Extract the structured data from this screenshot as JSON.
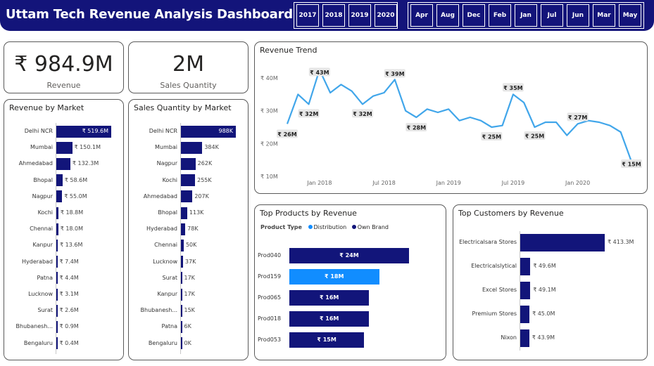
{
  "header": {
    "title": "Uttam Tech Revenue Analysis Dashboard",
    "years": [
      "2017",
      "2018",
      "2019",
      "2020"
    ],
    "months": [
      "Apr",
      "Aug",
      "Dec",
      "Feb",
      "Jan",
      "Jul",
      "Jun",
      "Mar",
      "May"
    ]
  },
  "colors": {
    "navy": "#12157a",
    "accent": "#118dff",
    "line": "#41a6ea"
  },
  "kpis": {
    "revenue": {
      "value": "₹ 984.9M",
      "label": "Revenue"
    },
    "sales_qty": {
      "value": "2M",
      "label": "Sales Quantity"
    }
  },
  "revenue_by_market": {
    "title": "Revenue by Market",
    "rows": [
      {
        "market": "Delhi NCR",
        "value": 519.6,
        "label": "₹ 519.6M"
      },
      {
        "market": "Mumbai",
        "value": 150.1,
        "label": "₹ 150.1M"
      },
      {
        "market": "Ahmedabad",
        "value": 132.3,
        "label": "₹ 132.3M"
      },
      {
        "market": "Bhopal",
        "value": 58.6,
        "label": "₹ 58.6M"
      },
      {
        "market": "Nagpur",
        "value": 55.0,
        "label": "₹ 55.0M"
      },
      {
        "market": "Kochi",
        "value": 18.8,
        "label": "₹ 18.8M"
      },
      {
        "market": "Chennai",
        "value": 18.0,
        "label": "₹ 18.0M"
      },
      {
        "market": "Kanpur",
        "value": 13.6,
        "label": "₹ 13.6M"
      },
      {
        "market": "Hyderabad",
        "value": 7.4,
        "label": "₹ 7.4M"
      },
      {
        "market": "Patna",
        "value": 4.4,
        "label": "₹ 4.4M"
      },
      {
        "market": "Lucknow",
        "value": 3.1,
        "label": "₹ 3.1M"
      },
      {
        "market": "Surat",
        "value": 2.6,
        "label": "₹ 2.6M"
      },
      {
        "market": "Bhubanesh...",
        "value": 0.9,
        "label": "₹ 0.9M"
      },
      {
        "market": "Bengaluru",
        "value": 0.4,
        "label": "₹ 0.4M"
      }
    ]
  },
  "sales_qty_by_market": {
    "title": "Sales Quantity by Market",
    "rows": [
      {
        "market": "Delhi NCR",
        "value": 988,
        "label": "988K"
      },
      {
        "market": "Mumbai",
        "value": 384,
        "label": "384K"
      },
      {
        "market": "Nagpur",
        "value": 262,
        "label": "262K"
      },
      {
        "market": "Kochi",
        "value": 255,
        "label": "255K"
      },
      {
        "market": "Ahmedabad",
        "value": 207,
        "label": "207K"
      },
      {
        "market": "Bhopal",
        "value": 113,
        "label": "113K"
      },
      {
        "market": "Hyderabad",
        "value": 78,
        "label": "78K"
      },
      {
        "market": "Chennai",
        "value": 50,
        "label": "50K"
      },
      {
        "market": "Lucknow",
        "value": 37,
        "label": "37K"
      },
      {
        "market": "Surat",
        "value": 17,
        "label": "17K"
      },
      {
        "market": "Kanpur",
        "value": 17,
        "label": "17K"
      },
      {
        "market": "Bhubanesh...",
        "value": 15,
        "label": "15K"
      },
      {
        "market": "Patna",
        "value": 6,
        "label": "6K"
      },
      {
        "market": "Bengaluru",
        "value": 0,
        "label": "0K"
      }
    ]
  },
  "chart_data": [
    {
      "type": "line",
      "title": "Revenue Trend",
      "xlabel": "",
      "ylabel": "",
      "y_ticks": [
        "₹ 10M",
        "₹ 20M",
        "₹ 30M",
        "₹ 40M"
      ],
      "ylim": [
        10,
        43
      ],
      "x_ticks": [
        "Jan 2018",
        "Jul 2018",
        "Jan 2019",
        "Jul 2019",
        "Jan 2020"
      ],
      "x": [
        "2017-10",
        "2017-11",
        "2017-12",
        "2018-01",
        "2018-02",
        "2018-03",
        "2018-04",
        "2018-05",
        "2018-06",
        "2018-07",
        "2018-08",
        "2018-09",
        "2018-10",
        "2018-11",
        "2018-12",
        "2019-01",
        "2019-02",
        "2019-03",
        "2019-04",
        "2019-05",
        "2019-06",
        "2019-07",
        "2019-08",
        "2019-09",
        "2019-10",
        "2019-11",
        "2019-12",
        "2020-01",
        "2020-02",
        "2020-03",
        "2020-04",
        "2020-05",
        "2020-06"
      ],
      "values": [
        26,
        35,
        32,
        42.5,
        35.5,
        38,
        36,
        32,
        34.5,
        35.5,
        39.5,
        30,
        28,
        30.5,
        29.5,
        30.5,
        27,
        28,
        27,
        25,
        25.5,
        35,
        32.5,
        25,
        26.5,
        26.5,
        22.5,
        26,
        27,
        26.5,
        25.5,
        23.5,
        14.5
      ],
      "data_labels": [
        {
          "index": 0,
          "text": "₹ 26M"
        },
        {
          "index": 2,
          "text": "₹ 32M"
        },
        {
          "index": 3,
          "text": "₹ 43M"
        },
        {
          "index": 7,
          "text": "₹ 32M"
        },
        {
          "index": 10,
          "text": "₹ 39M"
        },
        {
          "index": 12,
          "text": "₹ 28M"
        },
        {
          "index": 19,
          "text": "₹ 25M"
        },
        {
          "index": 21,
          "text": "₹ 35M"
        },
        {
          "index": 23,
          "text": "₹ 25M"
        },
        {
          "index": 27,
          "text": "₹ 27M"
        },
        {
          "index": 32,
          "text": "₹ 15M"
        }
      ],
      "grid": false
    },
    {
      "type": "bar",
      "title": "Top Products by Revenue",
      "legend": {
        "title": "Product Type",
        "items": [
          {
            "name": "Distribution",
            "color": "#118dff"
          },
          {
            "name": "Own Brand",
            "color": "#12157a"
          }
        ]
      },
      "categories": [
        "Prod040",
        "Prod159",
        "Prod065",
        "Prod018",
        "Prod053"
      ],
      "values": [
        24,
        18,
        16,
        16,
        15
      ],
      "types": [
        "Own Brand",
        "Distribution",
        "Own Brand",
        "Own Brand",
        "Own Brand"
      ],
      "labels": [
        "₹ 24M",
        "₹ 18M",
        "₹ 16M",
        "₹ 16M",
        "₹ 15M"
      ]
    },
    {
      "type": "bar",
      "title": "Top Customers by Revenue",
      "categories": [
        "Electricalsara Stores",
        "Electricalslytical",
        "Excel Stores",
        "Premium Stores",
        "Nixon"
      ],
      "values": [
        413.3,
        49.6,
        49.1,
        45.0,
        43.9
      ],
      "labels": [
        "₹ 413.3M",
        "₹ 49.6M",
        "₹ 49.1M",
        "₹ 45.0M",
        "₹ 43.9M"
      ]
    }
  ]
}
